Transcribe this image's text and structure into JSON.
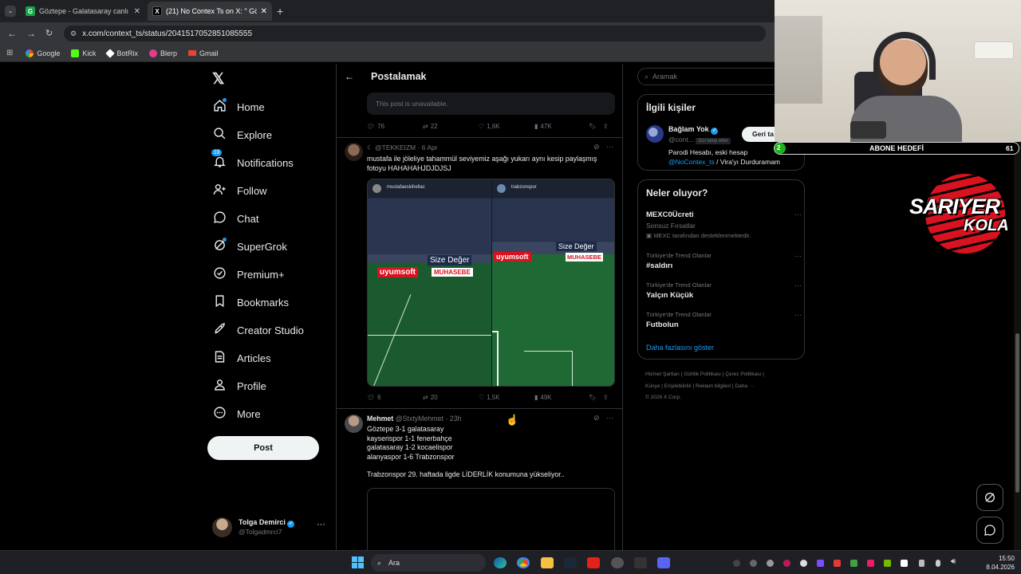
{
  "browser": {
    "tabs": [
      {
        "title": "Göztepe - Galatasaray canlı sko",
        "favicon": "G"
      },
      {
        "title": "(21) No Contex Ts on X: \" Gö",
        "favicon": "X"
      }
    ],
    "address": "x.com/context_ts/status/2041517052851085555",
    "bookmarks": [
      "Google",
      "Kick",
      "BotRix",
      "Blerp",
      "Gmail"
    ]
  },
  "sidebar": {
    "items": [
      {
        "label": "Home",
        "icon": "home-icon"
      },
      {
        "label": "Explore",
        "icon": "search-icon"
      },
      {
        "label": "Notifications",
        "icon": "bell-icon",
        "badge": "19"
      },
      {
        "label": "Follow",
        "icon": "follow-icon"
      },
      {
        "label": "Chat",
        "icon": "chat-icon"
      },
      {
        "label": "SuperGrok",
        "icon": "grok-icon"
      },
      {
        "label": "Premium+",
        "icon": "premium-icon"
      },
      {
        "label": "Bookmarks",
        "icon": "bookmark-icon"
      },
      {
        "label": "Creator Studio",
        "icon": "rocket-icon"
      },
      {
        "label": "Articles",
        "icon": "articles-icon"
      },
      {
        "label": "Profile",
        "icon": "person-icon"
      },
      {
        "label": "More",
        "icon": "more-icon"
      }
    ],
    "post_button": "Post",
    "account": {
      "name": "Tolga Demirci",
      "handle": "@Tolgadmrci7"
    }
  },
  "header": {
    "title": "Postalamak"
  },
  "posts": {
    "unavailable": {
      "text": "This post is unavailable.",
      "replies": "76",
      "reposts": "22",
      "likes": "1,6K",
      "views": "47K"
    },
    "quote": {
      "handle": "@TEKKEIZM",
      "date": "6 Apr",
      "text1": "mustafa ile jöleliye tahammül seviyemiz aşağı yukarı aynı kesip paylaşmış",
      "text2": "fotoyu HAHAHAHJDJDJSJ",
      "img_left_user": "mustafaeskihellac",
      "img_right_user": "trabzonspor",
      "sponsor1": "Size Değer",
      "sponsor2": "uyumsoft",
      "sponsor3": "MUHASEBE",
      "replies": "6",
      "reposts": "20",
      "likes": "1,5K",
      "views": "49K"
    },
    "reply": {
      "name": "Mehmet",
      "handle": "@StxtyMehmet",
      "time": "23h",
      "lines": [
        "Göztepe 3-1 galatasaray",
        "kayserispor 1-1 fenerbahçe",
        "galatasaray 1-2 kocaelispor",
        "alanyaspor 1-6 Trabzonspor"
      ],
      "footer": "Trabzonspor 29. haftada ligde LİDERLİK konumuna yükseliyor.."
    }
  },
  "right": {
    "search_placeholder": "Aramak",
    "related": {
      "title": "İlgili kişiler",
      "name": "Bağlam Yok",
      "handle": "@cont...",
      "follows_you": "Sizi takip eder",
      "follow_btn": "Geri ta",
      "bio1": "Parodi Hesabı, eski hesap",
      "bio_link": "@NoContex_ts",
      "bio2": " / Vira'yı Durduramam"
    },
    "trends_title": "Neler oluyor?",
    "promo": {
      "title": "MEXC0Ücreti",
      "sub": "Sonsuz Fırsatlar",
      "note": "MEXC tarafından desteklenmektedir."
    },
    "trends": [
      {
        "meta": "Türkiye'de Trend Olanlar",
        "name": "#saldırı"
      },
      {
        "meta": "Türkiye'de Trend Olanlar",
        "name": "Yalçın Küçük"
      },
      {
        "meta": "Türkiye'de Trend Olanlar",
        "name": "Futbolun"
      }
    ],
    "show_more": "Daha fazlasını göster",
    "footer1": [
      "Hizmet Şartları",
      "Gizlilik Politikası",
      "Çerez Politikası"
    ],
    "footer2": [
      "Künye",
      "Erişilebilirlik",
      "Reklam bilgileri",
      "Daha ···"
    ],
    "copyright": "© 2026 X Corp."
  },
  "overlay": {
    "goal_label": "ABONE HEDEFİ",
    "goal_current": "2",
    "goal_target": "61",
    "goal_progress": 0.033,
    "logo_line1": "SARIYER",
    "logo_line2": "KOLA"
  },
  "taskbar": {
    "search": "Ara",
    "time": "15:50",
    "date": "8.04.2026"
  },
  "colors": {
    "accent": "#1d9bf0",
    "post_button": "#eff3f4",
    "logo_red": "#d8121f"
  }
}
